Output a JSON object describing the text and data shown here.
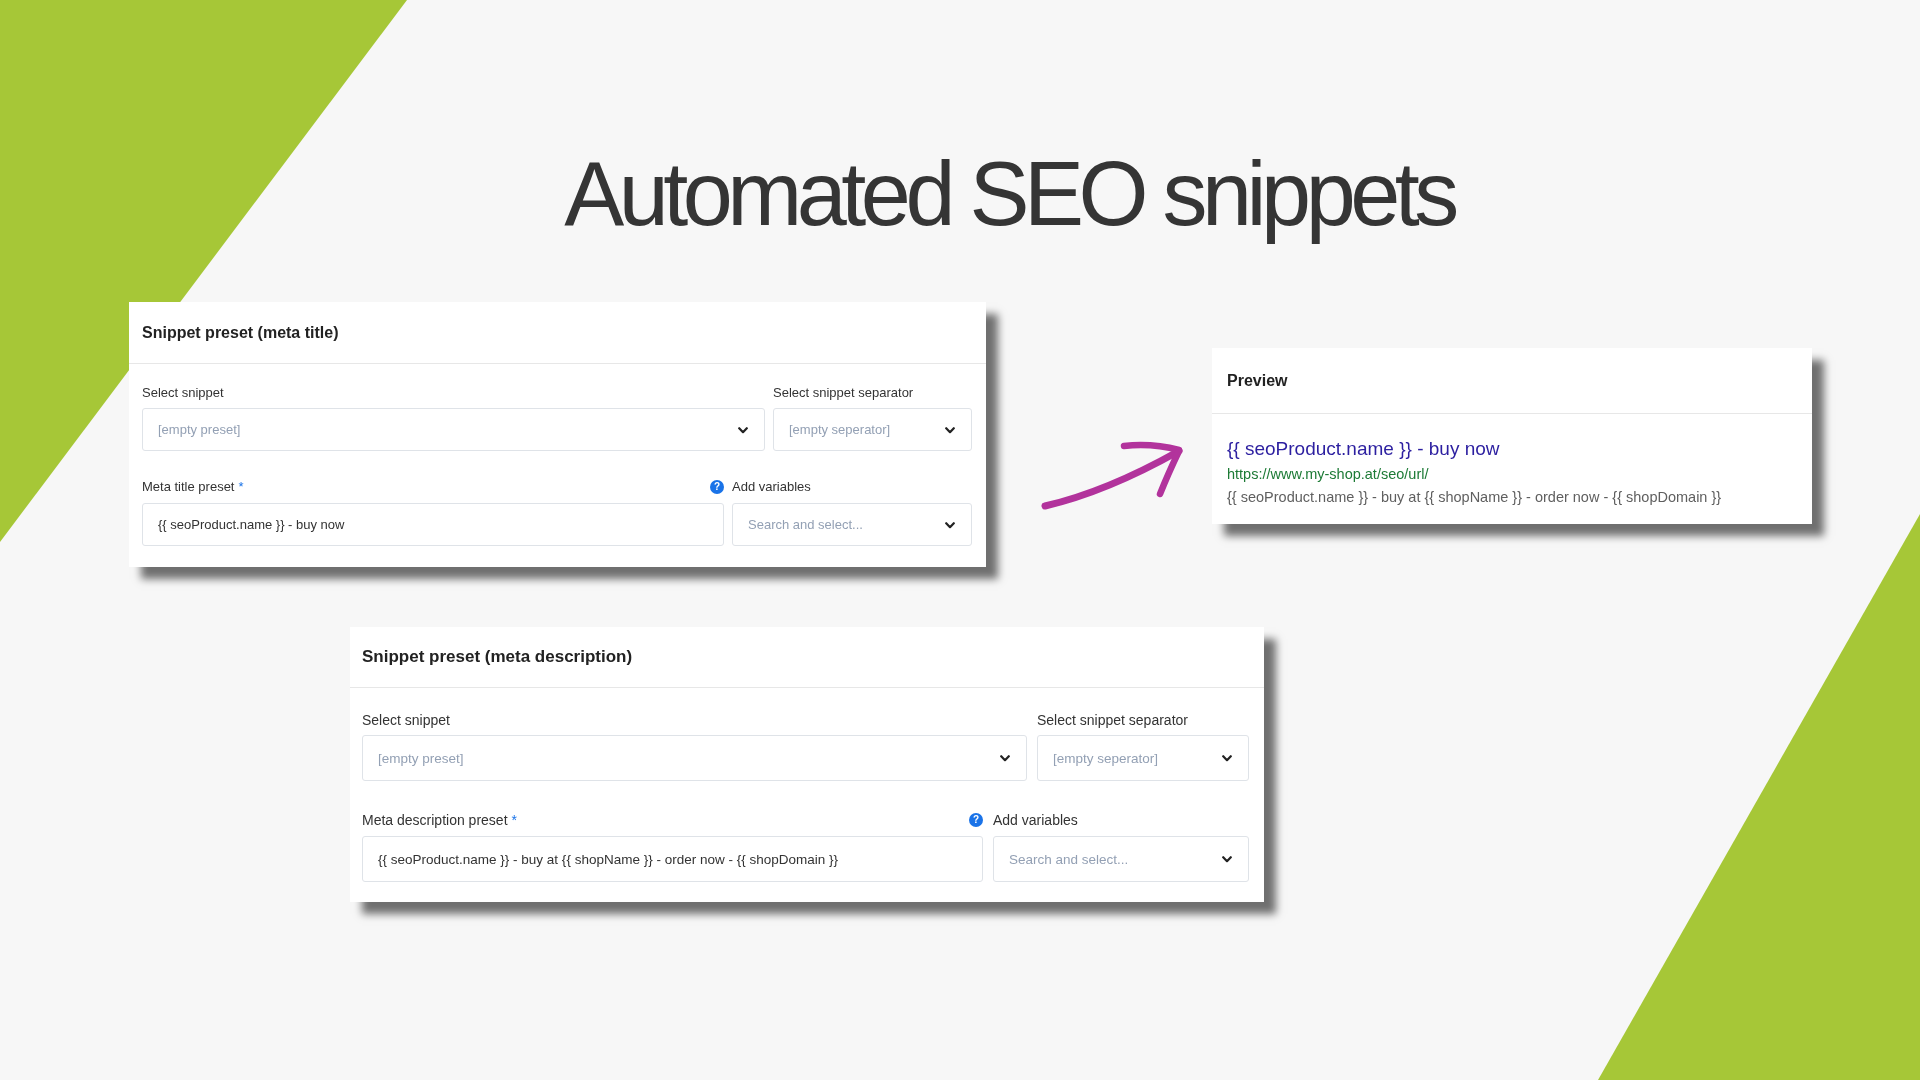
{
  "heading": "Automated SEO snippets",
  "meta_title_card": {
    "title": "Snippet preset (meta title)",
    "select_snippet": {
      "label": "Select snippet",
      "placeholder": "[empty preset]"
    },
    "select_separator": {
      "label": "Select snippet separator",
      "placeholder": "[empty seperator]"
    },
    "preset": {
      "label": "Meta title preset",
      "required_mark": "*",
      "value": "{{ seoProduct.name }} - buy now"
    },
    "add_variables": {
      "help": "?",
      "label": "Add variables",
      "placeholder": "Search and select..."
    }
  },
  "preview_card": {
    "title": "Preview",
    "result_title": "{{ seoProduct.name }} - buy now",
    "result_url": "https://www.my-shop.at/seo/url/",
    "result_description": "{{ seoProduct.name }} - buy at {{ shopName }} - order now - {{ shopDomain }}"
  },
  "meta_description_card": {
    "title": "Snippet preset (meta description)",
    "select_snippet": {
      "label": "Select snippet",
      "placeholder": "[empty preset]"
    },
    "select_separator": {
      "label": "Select snippet separator",
      "placeholder": "[empty seperator]"
    },
    "preset": {
      "label": "Meta description preset",
      "required_mark": "*",
      "value": "{{ seoProduct.name }} - buy at {{ shopName }} - order now - {{ shopDomain }}"
    },
    "add_variables": {
      "help": "?",
      "label": "Add variables",
      "placeholder": "Search and select..."
    }
  }
}
